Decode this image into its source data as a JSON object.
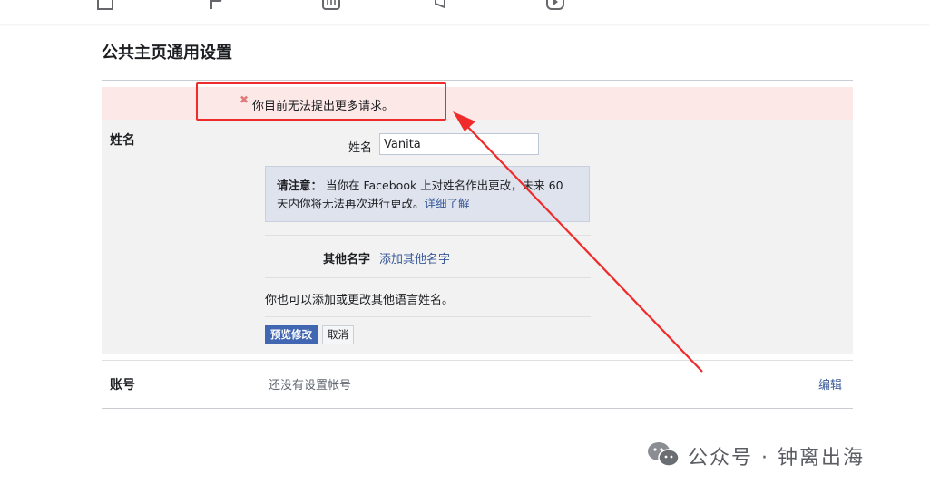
{
  "page": {
    "title": "公共主页通用设置"
  },
  "error": {
    "message": "你目前无法提出更多请求。",
    "icon": "close-icon",
    "color": "#e07a7a",
    "highlight_color": "#ef2b2b"
  },
  "name_section": {
    "label": "姓名",
    "field_label": "姓名",
    "name_value": "Vanita",
    "notice": {
      "prefix": "请注意：",
      "body": "当你在 Facebook 上对姓名作出更改，未来 60 天内你将无法再次进行更改。",
      "link": "详细了解"
    },
    "other_names": {
      "label": "其他名字",
      "link": "添加其他名字"
    },
    "language_note": "你也可以添加或更改其他语言姓名。",
    "buttons": {
      "preview": "预览修改",
      "cancel": "取消"
    }
  },
  "account_section": {
    "label": "账号",
    "value": "还没有设置帐号",
    "edit": "编辑"
  },
  "watermark": {
    "text": "公众号 · 钟离出海",
    "icon": "wechat-icon"
  },
  "colors": {
    "brand": "#4267b2",
    "link": "#385898",
    "error_bg": "#fde8e8",
    "section_bg": "#f2f2f2"
  }
}
